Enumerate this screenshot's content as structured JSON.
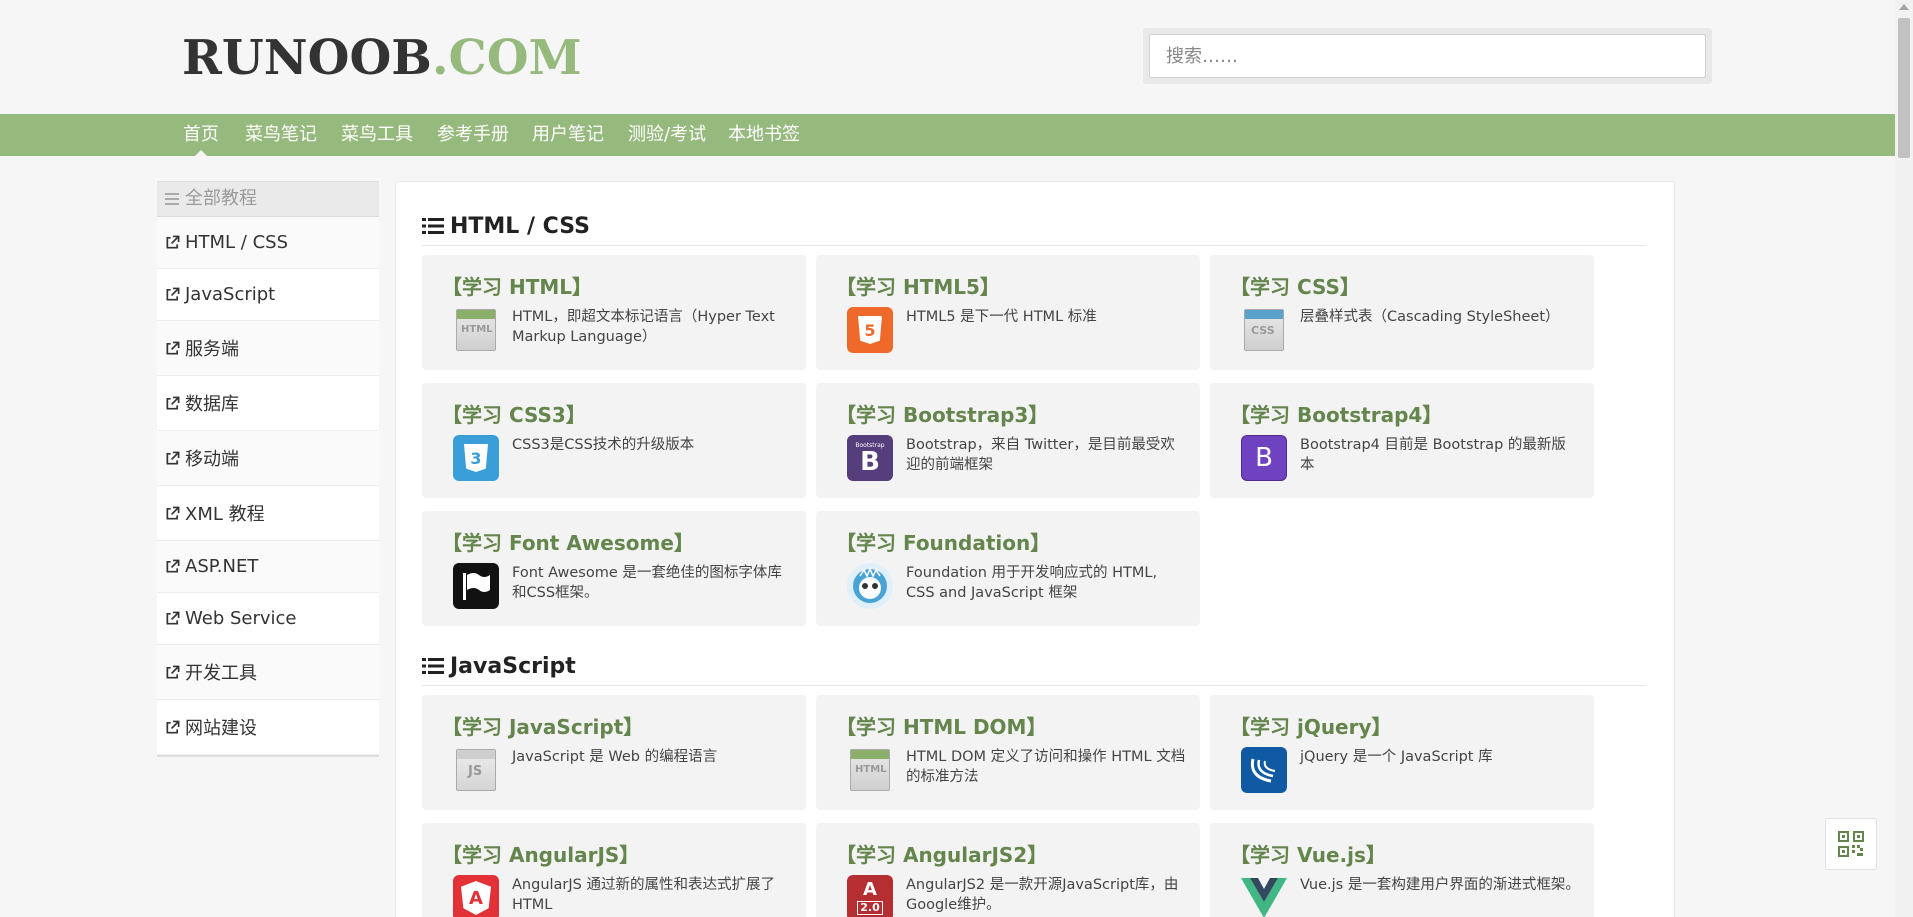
{
  "logo": {
    "part1": "RUNOOB",
    "part2": ".COM"
  },
  "search": {
    "placeholder": "搜索……"
  },
  "nav": [
    "首页",
    "菜鸟笔记",
    "菜鸟工具",
    "参考手册",
    "用户笔记",
    "测验/考试",
    "本地书签"
  ],
  "sidebar": {
    "header": "全部教程",
    "items": [
      "HTML / CSS",
      "JavaScript",
      "服务端",
      "数据库",
      "移动端",
      "XML 教程",
      "ASP.NET",
      "Web Service",
      "开发工具",
      "网站建设"
    ]
  },
  "sections": [
    {
      "title": "HTML / CSS",
      "cards": [
        {
          "title": "【学习 HTML】",
          "desc": "HTML，即超文本标记语言（Hyper Text Markup Language）",
          "icon": "html-file-icon"
        },
        {
          "title": "【学习 HTML5】",
          "desc": "HTML5 是下一代 HTML 标准",
          "icon": "html5-icon"
        },
        {
          "title": "【学习 CSS】",
          "desc": "层叠样式表（Cascading StyleSheet）",
          "icon": "css-file-icon"
        },
        {
          "title": "【学习 CSS3】",
          "desc": "CSS3是CSS技术的升级版本",
          "icon": "css3-icon"
        },
        {
          "title": "【学习 Bootstrap3】",
          "desc": "Bootstrap，来自 Twitter，是目前最受欢迎的前端框架",
          "icon": "bootstrap3-icon"
        },
        {
          "title": "【学习 Bootstrap4】",
          "desc": "Bootstrap4 目前是 Bootstrap 的最新版本",
          "icon": "bootstrap4-icon"
        },
        {
          "title": "【学习 Font Awesome】",
          "desc": "Font Awesome 是一套绝佳的图标字体库和CSS框架。",
          "icon": "font-awesome-flag-icon"
        },
        {
          "title": "【学习 Foundation】",
          "desc": "Foundation 用于开发响应式的 HTML, CSS and JavaScript 框架",
          "icon": "foundation-icon"
        }
      ]
    },
    {
      "title": "JavaScript",
      "cards": [
        {
          "title": "【学习 JavaScript】",
          "desc": "JavaScript 是 Web 的编程语言",
          "icon": "js-file-icon"
        },
        {
          "title": "【学习 HTML DOM】",
          "desc": "HTML DOM 定义了访问和操作 HTML 文档的标准方法",
          "icon": "html-file-icon"
        },
        {
          "title": "【学习 jQuery】",
          "desc": "jQuery 是一个 JavaScript 库",
          "icon": "jquery-icon"
        },
        {
          "title": "【学习 AngularJS】",
          "desc": "AngularJS 通过新的属性和表达式扩展了 HTML",
          "icon": "angularjs-icon"
        },
        {
          "title": "【学习 AngularJS2】",
          "desc": "AngularJS2 是一款开源JavaScript库，由Google维护。",
          "icon": "angularjs2-icon"
        },
        {
          "title": "【学习 Vue.js】",
          "desc": "Vue.js 是一套构建用户界面的渐进式框架。",
          "icon": "vuejs-icon"
        }
      ]
    }
  ],
  "icon_text": {
    "html": "HTML",
    "html5": "5",
    "css": "CSS",
    "css3": "3",
    "bs": "B",
    "bs_small": "Bootstrap",
    "js": "JS",
    "ng": "A",
    "ng2": "2.0"
  },
  "colors": {
    "accent": "#96b97d",
    "card_title": "#64854c"
  }
}
